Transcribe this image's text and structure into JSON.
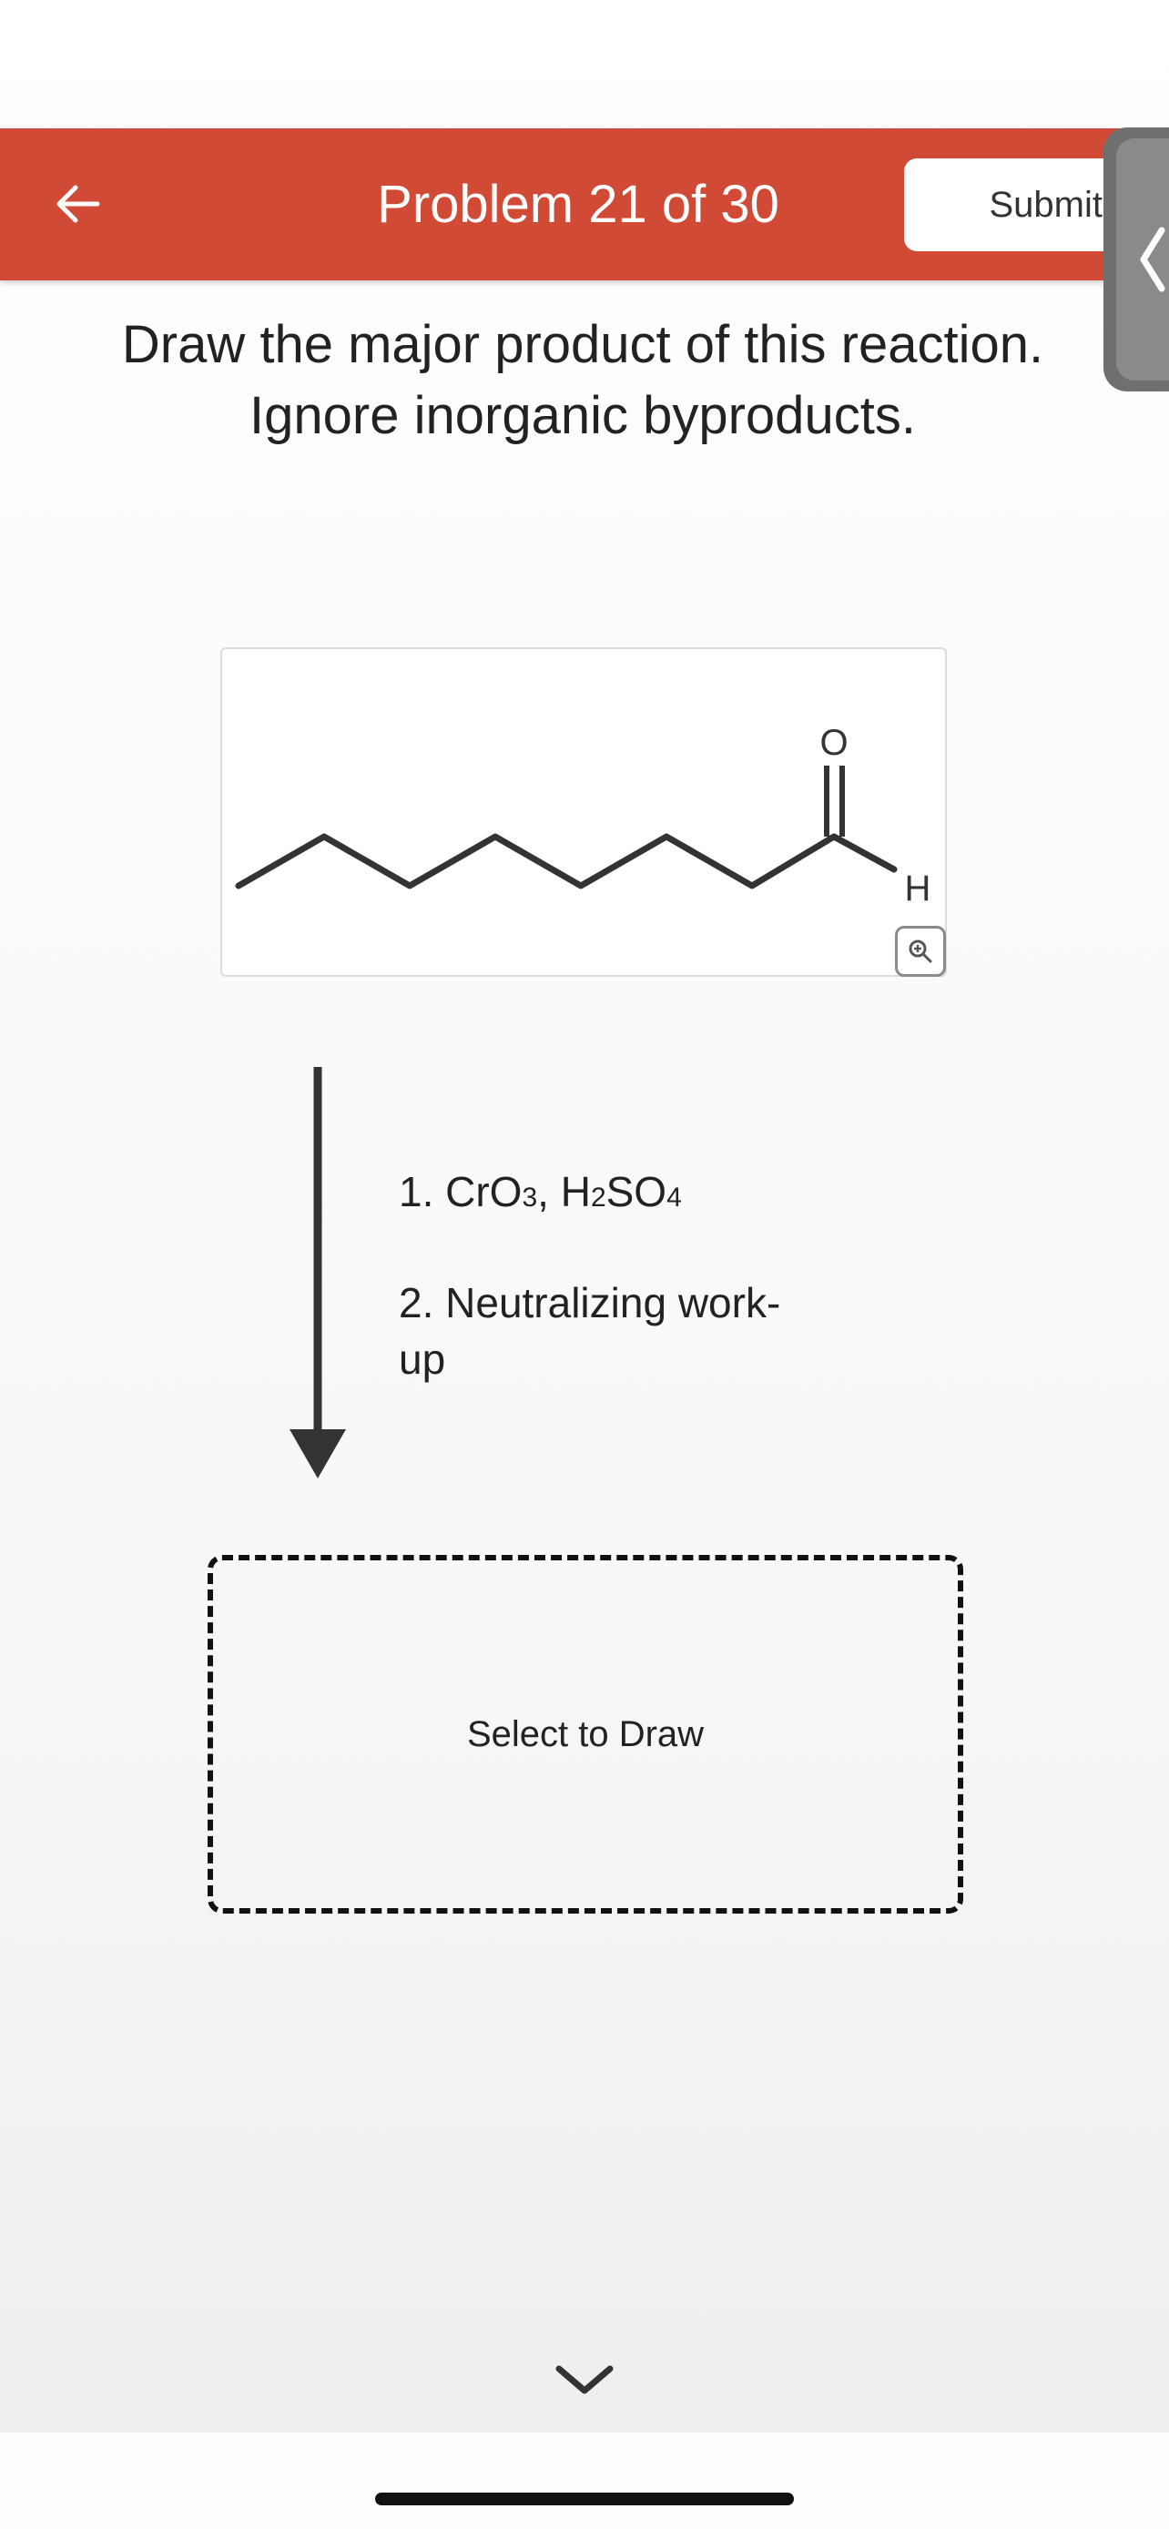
{
  "header": {
    "title": "Problem 21 of 30",
    "submit_label": "Submit",
    "back_icon": "arrow-left-icon",
    "color": "#d04a35"
  },
  "side_panel": {
    "icon": "chevron-left-icon"
  },
  "question": {
    "line1": "Draw the major product of this reaction.",
    "line2": "Ignore inorganic byproducts."
  },
  "reactant": {
    "atom_O": "O",
    "atom_H": "H",
    "zoom_icon": "zoom-in-icon"
  },
  "reagents": {
    "step1_prefix": "1. CrO",
    "step1_sub1": "3",
    "step1_mid": ", H",
    "step1_sub2": "2",
    "step1_so": "SO",
    "step1_sub3": "4",
    "step2_line1": "2. Neutralizing work-",
    "step2_line2": "up"
  },
  "answer_box": {
    "label": "Select to Draw"
  },
  "footer": {
    "next_icon": "chevron-down-icon"
  }
}
